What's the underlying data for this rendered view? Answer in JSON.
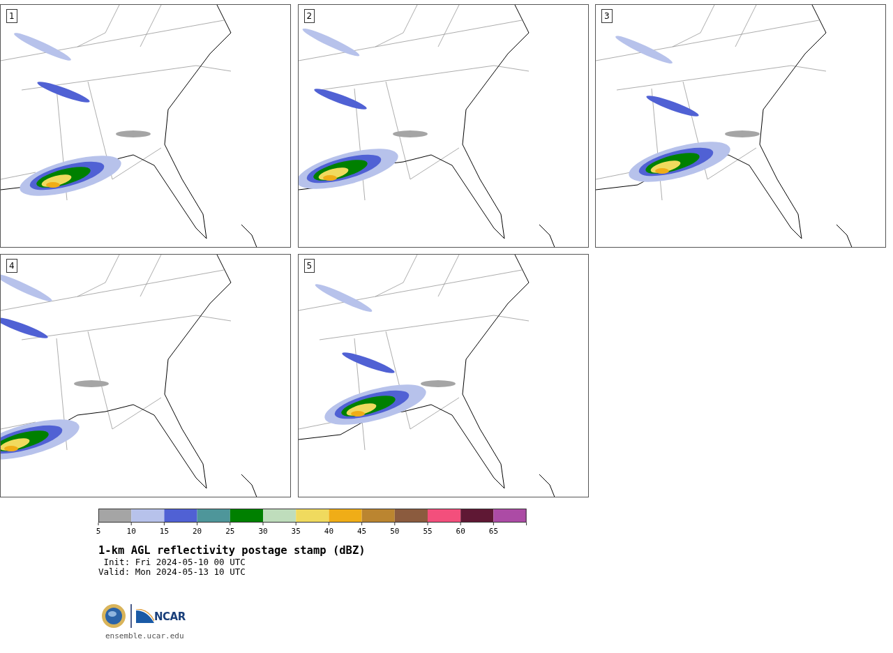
{
  "panels": [
    {
      "label": "1"
    },
    {
      "label": "2"
    },
    {
      "label": "3"
    },
    {
      "label": "4"
    },
    {
      "label": "5"
    }
  ],
  "colorbar": {
    "bins": [
      {
        "color": "#a5a5a5"
      },
      {
        "color": "#b7c2eb"
      },
      {
        "color": "#5061d4"
      },
      {
        "color": "#4e969a"
      },
      {
        "color": "#008000"
      },
      {
        "color": "#bfddbc"
      },
      {
        "color": "#f0da5e"
      },
      {
        "color": "#f0ad17"
      },
      {
        "color": "#bb8530"
      },
      {
        "color": "#8b5b3e"
      },
      {
        "color": "#f34f7c"
      },
      {
        "color": "#5f1834"
      },
      {
        "color": "#ac4ba5"
      }
    ],
    "ticks": [
      "5",
      "10",
      "15",
      "20",
      "25",
      "30",
      "35",
      "40",
      "45",
      "50",
      "55",
      "60",
      "65"
    ]
  },
  "title": "1-km AGL reflectivity postage stamp (dBZ)",
  "init": " Init: Fri 2024-05-10 00 UTC",
  "valid": "Valid: Mon 2024-05-13 10 UTC",
  "logo": {
    "org_text": "NCAR"
  },
  "site": "ensemble.ucar.edu"
}
